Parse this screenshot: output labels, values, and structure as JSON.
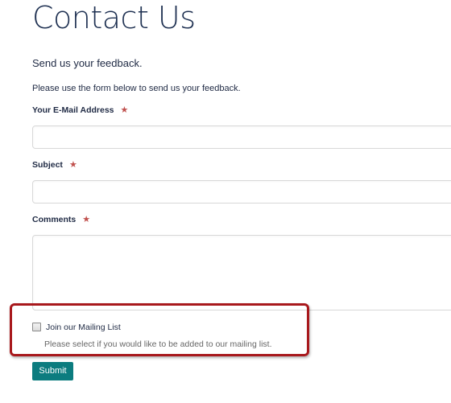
{
  "page": {
    "title": "Contact Us",
    "subtitle": "Send us your feedback.",
    "intro": "Please use the form below to send us your feedback."
  },
  "form": {
    "email": {
      "label": "Your E-Mail Address",
      "required_marker": "★",
      "value": ""
    },
    "subject": {
      "label": "Subject",
      "required_marker": "★",
      "value": ""
    },
    "comments": {
      "label": "Comments",
      "required_marker": "★",
      "value": ""
    },
    "mailing_list": {
      "label": "Join our Mailing List",
      "helper": "Please select if you would like to be added to our mailing list.",
      "checked": false
    },
    "submit_label": "Submit"
  },
  "colors": {
    "accent": "#0c7c7f",
    "required": "#c0504d",
    "highlight": "#a8181c"
  }
}
